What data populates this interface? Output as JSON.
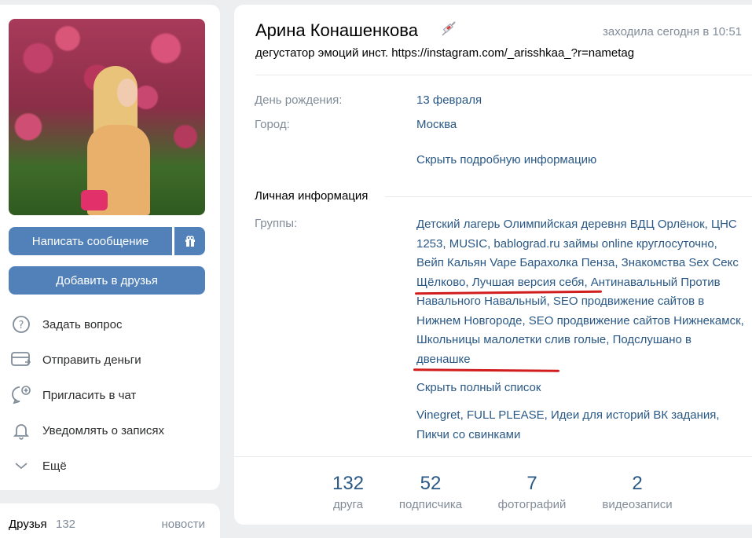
{
  "profile": {
    "name": "Арина Конашенкова",
    "last_seen": "заходила сегодня в 10:51",
    "status": "дегустатор эмоций инст. https://instagram.com/_arisshkaa_?r=nametag"
  },
  "actions": {
    "message": "Написать сообщение",
    "add_friend": "Добавить в друзья",
    "list": [
      {
        "label": "Задать вопрос",
        "icon": "question-icon"
      },
      {
        "label": "Отправить деньги",
        "icon": "money-icon"
      },
      {
        "label": "Пригласить в чат",
        "icon": "chat-invite-icon"
      },
      {
        "label": "Уведомлять о записях",
        "icon": "bell-icon"
      },
      {
        "label": "Ещё",
        "icon": "chevron-down-icon"
      }
    ]
  },
  "info": {
    "birthday_label": "День рождения:",
    "birthday": "13 февраля",
    "city_label": "Город:",
    "city": "Москва",
    "hide_detail": "Скрыть подробную информацию",
    "section_personal": "Личная информация",
    "groups_label": "Группы:",
    "groups": [
      "Детский лагерь Олимпийская деревня ВДЦ Орлёнок",
      "ЦНС 1253",
      "MUSIC",
      "bablograd.ru займы online круглосуточно",
      "Вейп Кальян Vape Барахолка Пенза",
      "Знакомства Sex Секс Щёлково",
      "Лучшая версия себя",
      "Антинавальный Против Навального Навальный",
      "SEO продвижение сайтов в Нижнем Новгороде",
      "SEO продвижение сайтов Нижнекамск",
      "Школьницы малолетки слив голые",
      "Подслушано в двенашке"
    ],
    "hide_full": "Скрыть полный список",
    "extra_groups": [
      "Vinegret",
      "FULL PLEASE",
      "Идеи для историй ВК задания",
      "Пикчи со свинками"
    ]
  },
  "stats": [
    {
      "num": "132",
      "cap": "друга"
    },
    {
      "num": "52",
      "cap": "подписчика"
    },
    {
      "num": "7",
      "cap": "фотографий"
    },
    {
      "num": "2",
      "cap": "видеозаписи"
    }
  ],
  "friends": {
    "title": "Друзья",
    "count": "132",
    "news": "новости"
  },
  "colors": {
    "accent": "#5181b8",
    "link": "#2a5885",
    "muted": "#818c99",
    "annotation": "#d11d1d"
  }
}
